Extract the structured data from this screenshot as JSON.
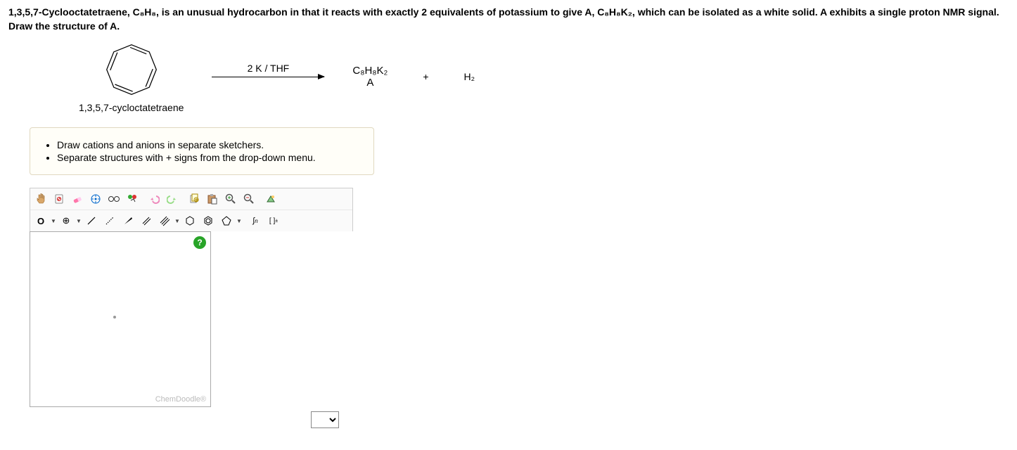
{
  "question": "1,3,5,7-Cyclooctatetraene, C₈H₈, is an unusual hydrocarbon in that it reacts with exactly 2 equivalents of potassium to give A, C₈H₈K₂, which can be isolated as a white solid. A exhibits a single proton NMR signal. Draw the structure of A.",
  "reaction": {
    "reactant_label": "1,3,5,7-cycloctatetraene",
    "arrow_label": "2 K / THF",
    "product_formula": "C₈H₈K₂",
    "product_label": "A",
    "plus": "+",
    "byproduct": "H₂"
  },
  "hints": [
    "Draw cations and anions in separate sketchers.",
    "Separate structures with + signs from the drop-down menu."
  ],
  "toolbar": {
    "row1": {
      "hand": "hand-icon",
      "erase": "erase-icon",
      "eraser": "eraser-tool-icon",
      "lasso": "lasso-icon",
      "glasses": "glasses-icon",
      "clean": "clean-icon",
      "undo": "undo-icon",
      "redo": "redo-icon",
      "copy": "copy-icon",
      "paste": "paste-icon",
      "zoomin": "zoom-in-icon",
      "zoomout": "zoom-out-icon",
      "settings": "settings-icon"
    },
    "row2": {
      "oxygen": "O",
      "charge": "⊕",
      "single": "single-bond-icon",
      "dotted": "dotted-bond-icon",
      "wedge": "wedge-bond-icon",
      "double": "double-bond-icon",
      "triple": "triple-bond-icon",
      "hexagon": "hexagon-icon",
      "benzene": "benzene-icon",
      "pentagon": "pentagon-icon",
      "subscript": "∫n",
      "bracket": "[ ]±"
    }
  },
  "canvas": {
    "help": "?",
    "watermark": "ChemDoodle®"
  }
}
